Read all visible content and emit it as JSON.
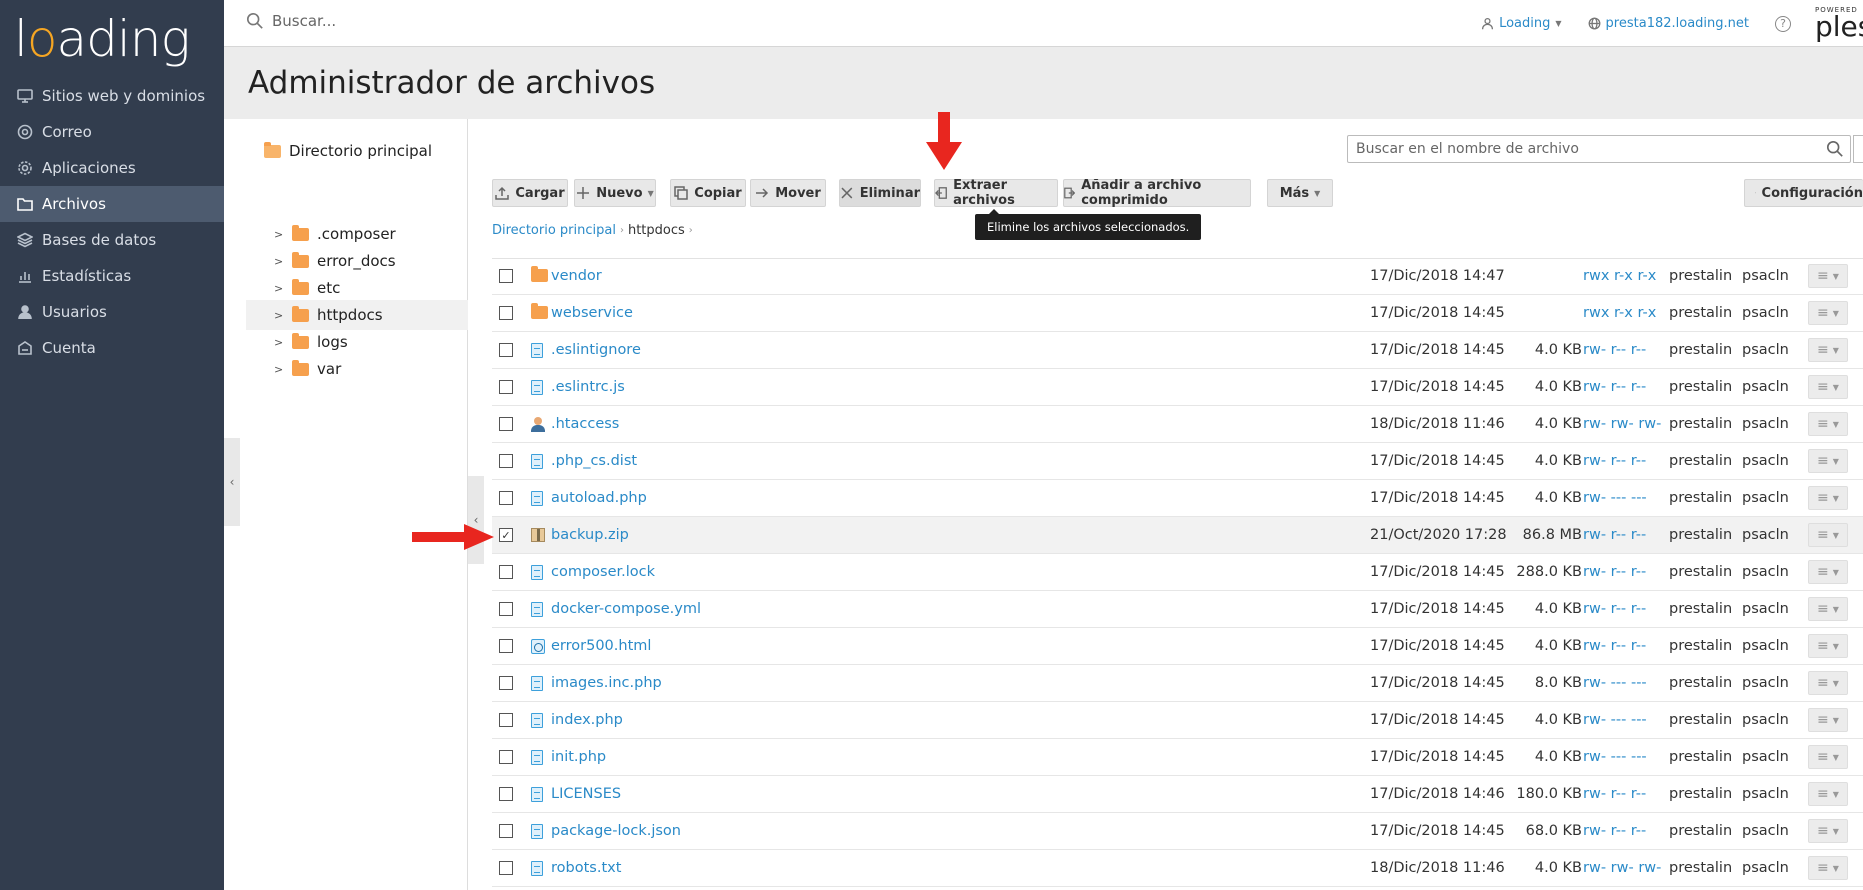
{
  "brand": {
    "logo_text": "loading",
    "accent_color": "#f6a623"
  },
  "sidebar": {
    "items": [
      {
        "label": "Sitios web y dominios",
        "icon": "monitor-icon",
        "active": false
      },
      {
        "label": "Correo",
        "icon": "mail-icon",
        "active": false
      },
      {
        "label": "Aplicaciones",
        "icon": "gear-icon",
        "active": false
      },
      {
        "label": "Archivos",
        "icon": "folder-icon",
        "active": true
      },
      {
        "label": "Bases de datos",
        "icon": "database-icon",
        "active": false
      },
      {
        "label": "Estadísticas",
        "icon": "chart-icon",
        "active": false
      },
      {
        "label": "Usuarios",
        "icon": "user-icon",
        "active": false
      },
      {
        "label": "Cuenta",
        "icon": "account-icon",
        "active": false
      }
    ]
  },
  "topbar": {
    "search_placeholder": "Buscar...",
    "user_label": "Loading",
    "domain_label": "presta182.loading.net",
    "help_icon": "?",
    "powered_label": "POWERED",
    "plesk_label": "ples"
  },
  "page": {
    "title": "Administrador de archivos"
  },
  "tree": {
    "root_label": "Directorio principal",
    "items": [
      {
        "label": ".composer",
        "active": false
      },
      {
        "label": "error_docs",
        "active": false
      },
      {
        "label": "etc",
        "active": false
      },
      {
        "label": "httpdocs",
        "active": true
      },
      {
        "label": "logs",
        "active": false
      },
      {
        "label": "var",
        "active": false
      }
    ]
  },
  "file_search": {
    "placeholder": "Buscar en el nombre de archivo"
  },
  "toolbar": {
    "upload": "Cargar",
    "new": "Nuevo",
    "copy": "Copiar",
    "move": "Mover",
    "delete": "Eliminar",
    "extract": "Extraer archivos",
    "add_archive": "Añadir a archivo comprimido",
    "more": "Más",
    "settings": "Configuración"
  },
  "tooltip": {
    "text": "Elimine los archivos seleccionados."
  },
  "breadcrumb": {
    "root": "Directorio principal",
    "current": "httpdocs"
  },
  "files": [
    {
      "name": "vendor",
      "type": "folder",
      "date": "17/Dic/2018 14:47",
      "size": "",
      "perm": "rwx r-x r-x",
      "user": "prestalin",
      "group": "psacln",
      "checked": false
    },
    {
      "name": "webservice",
      "type": "folder",
      "date": "17/Dic/2018 14:45",
      "size": "",
      "perm": "rwx r-x r-x",
      "user": "prestalin",
      "group": "psacln",
      "checked": false
    },
    {
      "name": ".eslintignore",
      "type": "doc",
      "date": "17/Dic/2018 14:45",
      "size": "4.0 KB",
      "perm": "rw- r-- r--",
      "user": "prestalin",
      "group": "psacln",
      "checked": false
    },
    {
      "name": ".eslintrc.js",
      "type": "doc",
      "date": "17/Dic/2018 14:45",
      "size": "4.0 KB",
      "perm": "rw- r-- r--",
      "user": "prestalin",
      "group": "psacln",
      "checked": false
    },
    {
      "name": ".htaccess",
      "type": "user",
      "date": "18/Dic/2018 11:46",
      "size": "4.0 KB",
      "perm": "rw- rw- rw-",
      "user": "prestalin",
      "group": "psacln",
      "checked": false
    },
    {
      "name": ".php_cs.dist",
      "type": "doc",
      "date": "17/Dic/2018 14:45",
      "size": "4.0 KB",
      "perm": "rw- r-- r--",
      "user": "prestalin",
      "group": "psacln",
      "checked": false
    },
    {
      "name": "autoload.php",
      "type": "doc",
      "date": "17/Dic/2018 14:45",
      "size": "4.0 KB",
      "perm": "rw- --- ---",
      "user": "prestalin",
      "group": "psacln",
      "checked": false
    },
    {
      "name": "backup.zip",
      "type": "zip",
      "date": "21/Oct/2020 17:28",
      "size": "86.8 MB",
      "perm": "rw- r-- r--",
      "user": "prestalin",
      "group": "psacln",
      "checked": true
    },
    {
      "name": "composer.lock",
      "type": "doc",
      "date": "17/Dic/2018 14:45",
      "size": "288.0 KB",
      "perm": "rw- r-- r--",
      "user": "prestalin",
      "group": "psacln",
      "checked": false
    },
    {
      "name": "docker-compose.yml",
      "type": "doc",
      "date": "17/Dic/2018 14:45",
      "size": "4.0 KB",
      "perm": "rw- r-- r--",
      "user": "prestalin",
      "group": "psacln",
      "checked": false
    },
    {
      "name": "error500.html",
      "type": "web",
      "date": "17/Dic/2018 14:45",
      "size": "4.0 KB",
      "perm": "rw- r-- r--",
      "user": "prestalin",
      "group": "psacln",
      "checked": false
    },
    {
      "name": "images.inc.php",
      "type": "doc",
      "date": "17/Dic/2018 14:45",
      "size": "8.0 KB",
      "perm": "rw- --- ---",
      "user": "prestalin",
      "group": "psacln",
      "checked": false
    },
    {
      "name": "index.php",
      "type": "doc",
      "date": "17/Dic/2018 14:45",
      "size": "4.0 KB",
      "perm": "rw- --- ---",
      "user": "prestalin",
      "group": "psacln",
      "checked": false
    },
    {
      "name": "init.php",
      "type": "doc",
      "date": "17/Dic/2018 14:45",
      "size": "4.0 KB",
      "perm": "rw- --- ---",
      "user": "prestalin",
      "group": "psacln",
      "checked": false
    },
    {
      "name": "LICENSES",
      "type": "doc",
      "date": "17/Dic/2018 14:46",
      "size": "180.0 KB",
      "perm": "rw- r-- r--",
      "user": "prestalin",
      "group": "psacln",
      "checked": false
    },
    {
      "name": "package-lock.json",
      "type": "doc",
      "date": "17/Dic/2018 14:45",
      "size": "68.0 KB",
      "perm": "rw- r-- r--",
      "user": "prestalin",
      "group": "psacln",
      "checked": false
    },
    {
      "name": "robots.txt",
      "type": "doc",
      "date": "18/Dic/2018 11:46",
      "size": "4.0 KB",
      "perm": "rw- rw- rw-",
      "user": "prestalin",
      "group": "psacln",
      "checked": false
    }
  ]
}
